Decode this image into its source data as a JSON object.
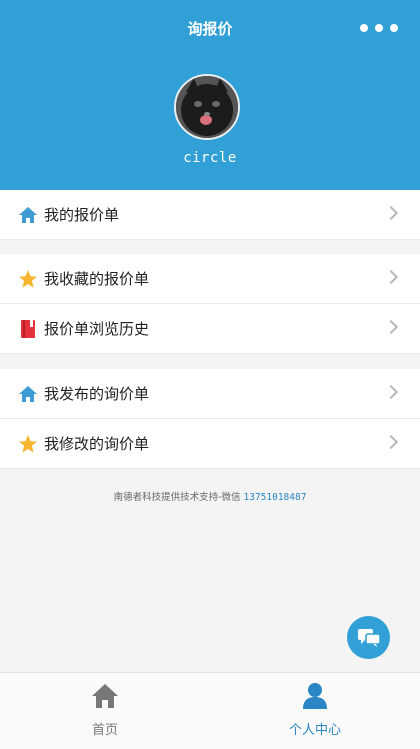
{
  "header": {
    "title": "询报价",
    "more_icon": "more-dots-icon",
    "background": "#31a0d6"
  },
  "profile": {
    "avatar": "cat-avatar",
    "username": "circle"
  },
  "menu_groups": [
    {
      "items": [
        {
          "label": "我的报价单",
          "icon": "home-icon",
          "icon_color": "#3f9bd3"
        }
      ]
    },
    {
      "items": [
        {
          "label": "我收藏的报价单",
          "icon": "star-icon",
          "icon_color": "#f5b52e"
        },
        {
          "label": "报价单浏览历史",
          "icon": "book-icon",
          "icon_color": "#e3323a"
        }
      ]
    },
    {
      "items": [
        {
          "label": "我发布的询价单",
          "icon": "home-icon",
          "icon_color": "#3f9bd3"
        },
        {
          "label": "我修改的询价单",
          "icon": "star-icon",
          "icon_color": "#f5b52e"
        }
      ]
    }
  ],
  "footer": {
    "text": "南德者科技提供技术支持-微信 ",
    "phone": "13751018487"
  },
  "chat_button": {
    "icon": "chat-bubble-icon"
  },
  "tabbar": {
    "tabs": [
      {
        "label": "首页",
        "icon": "home-icon",
        "active": false
      },
      {
        "label": "个人中心",
        "icon": "user-icon",
        "active": true
      }
    ],
    "active_color": "#2a86c4"
  }
}
